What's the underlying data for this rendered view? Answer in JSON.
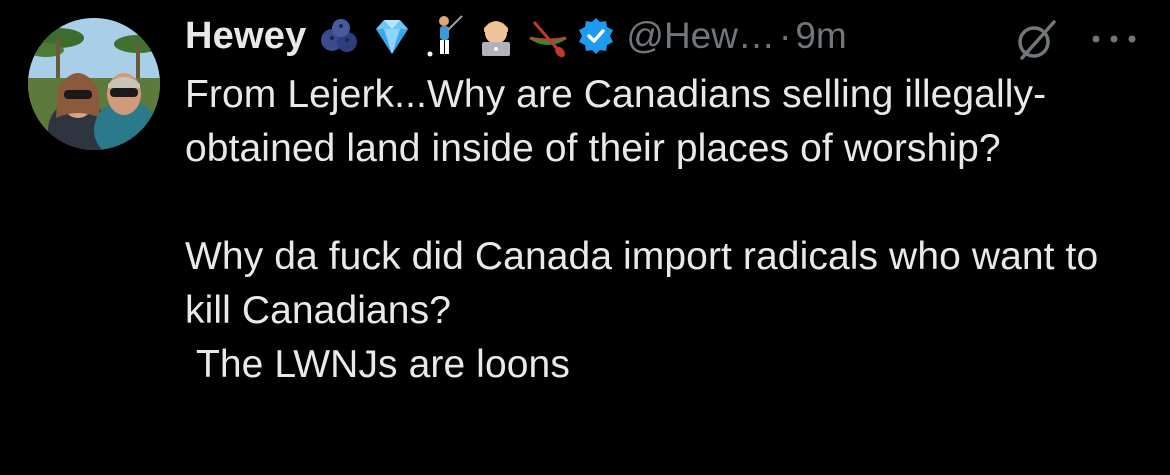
{
  "tweet": {
    "display_name": "Hewey",
    "name_emojis": [
      "blueberries-emoji",
      "gem-emoji",
      "golfer-emoji",
      "technologist-emoji",
      "canoe-emoji"
    ],
    "verified": true,
    "handle": "@Hew…",
    "separator": "·",
    "time": "9m",
    "text": "From Lejerk...Why are Canadians selling illegally-obtained land inside of their places of worship?\n\nWhy da fuck did Canada import radicals who want to kill Canadians?\n The LWNJs are loons"
  },
  "icons": {
    "grok": "grok-icon",
    "more": "more-options-icon"
  },
  "colors": {
    "background": "#000000",
    "text_primary": "#e7e9ea",
    "text_secondary": "#71767b",
    "verified_blue": "#1d9bf0"
  }
}
